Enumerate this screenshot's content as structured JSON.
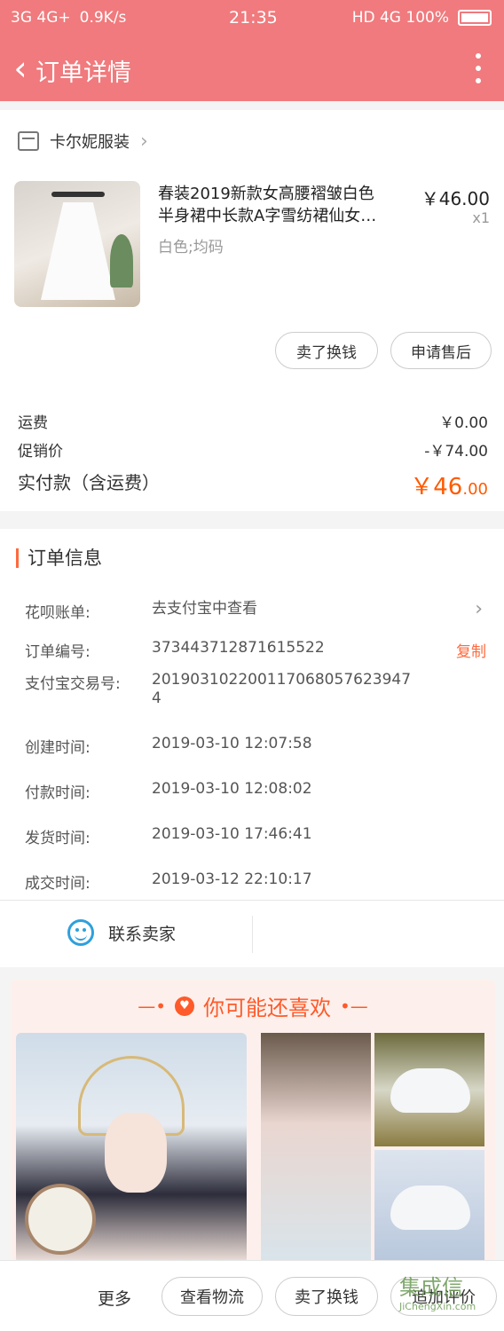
{
  "status_bar": {
    "signals": "3G  4G+",
    "speed": "0.9K/s",
    "time": "21:35",
    "right": "HD 4G 100%"
  },
  "nav": {
    "title": "订单详情"
  },
  "shop": {
    "name": "卡尔妮服装"
  },
  "product": {
    "title_line1": "春装2019新款女高腰褶皱白色",
    "title_line2": "半身裙中长款A字雪纺裙仙女…",
    "price": "￥46.00",
    "qty": "x1",
    "sku": "白色;均码"
  },
  "actions": {
    "sell": "卖了换钱",
    "after_sale": "申请售后"
  },
  "fees": {
    "shipping_label": "运费",
    "shipping_value": "￥0.00",
    "promo_label": "促销价",
    "promo_value": "-￥74.00",
    "paid_label": "实付款（含运费）",
    "paid_main": "￥46",
    "paid_decimal": ".00"
  },
  "order_info": {
    "title": "订单信息",
    "rows": [
      {
        "k": "花呗账单:",
        "v": "去支付宝中查看"
      },
      {
        "k": "订单编号:",
        "v": "373443712871615522",
        "action": "复制"
      },
      {
        "k": "支付宝交易号:",
        "v": "2019031022001170680576239474"
      },
      {
        "k": "创建时间:",
        "v": "2019-03-10 12:07:58"
      },
      {
        "k": "付款时间:",
        "v": "2019-03-10 12:08:02"
      },
      {
        "k": "发货时间:",
        "v": "2019-03-10 17:46:41"
      },
      {
        "k": "成交时间:",
        "v": "2019-03-12 22:10:17"
      }
    ]
  },
  "contact": {
    "label": "联系卖家"
  },
  "recommend": {
    "title": "你可能还喜欢"
  },
  "bottom": {
    "more": "更多",
    "logistics": "查看物流",
    "sell": "卖了换钱",
    "review": "追加评价"
  },
  "watermark": {
    "text": "集成信",
    "url": "JiChengXin.com"
  },
  "colors": {
    "header": "#f07a7d",
    "accent": "#ff5a2a",
    "link": "#2ea0dc"
  }
}
